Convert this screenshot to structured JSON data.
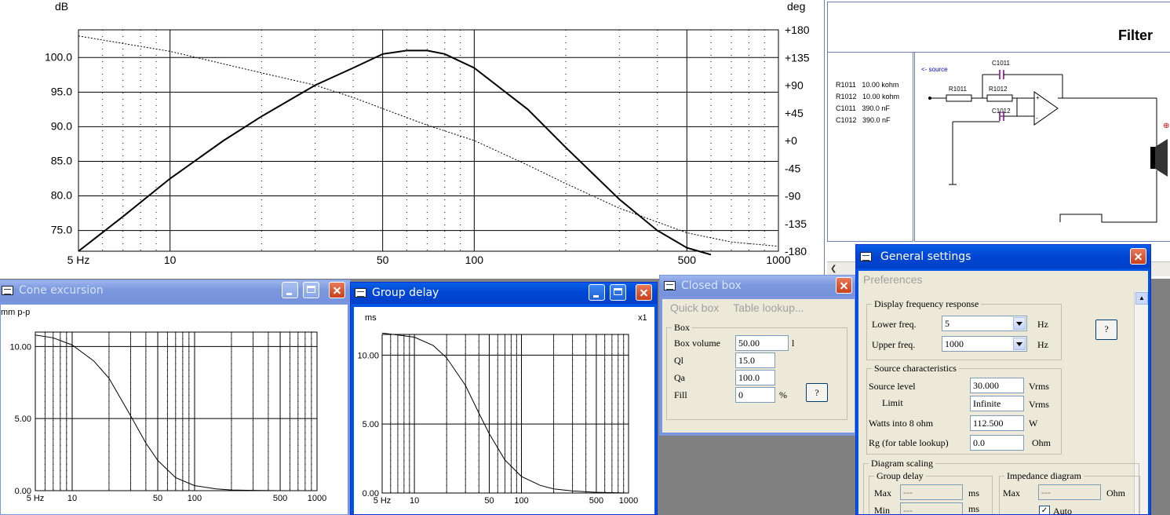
{
  "main_chart": {
    "y_unit_left": "dB",
    "y_unit_right": "deg",
    "y_ticks_left": [
      "100.0",
      "95.0",
      "90.0",
      "85.0",
      "80.0",
      "75.0"
    ],
    "y_ticks_right": [
      "+180",
      "+135",
      "+90",
      "+45",
      "+0",
      "-45",
      "-90",
      "-135",
      "-180"
    ],
    "x_ticks": [
      "5 Hz",
      "10",
      "50",
      "100",
      "500",
      "1000"
    ]
  },
  "chart_data": [
    {
      "type": "line",
      "ylabel": "dB",
      "x_scale": "log",
      "xlim": [
        5,
        1000
      ],
      "ylim": [
        72,
        104
      ],
      "y2_label": "deg",
      "y2lim": [
        -180,
        180
      ],
      "grid": true,
      "series": [
        {
          "x": [
            5,
            7,
            10,
            15,
            20,
            30,
            40,
            50,
            60,
            70,
            80,
            100,
            150,
            200,
            300,
            400,
            500,
            600
          ],
          "values": [
            72,
            77,
            82.5,
            88,
            91.5,
            96,
            98.5,
            100.5,
            101,
            101,
            100.5,
            98.5,
            92.5,
            87,
            79.5,
            75,
            72.5,
            71.5
          ]
        },
        {
          "axis": "right",
          "x": [
            5,
            10,
            20,
            30,
            40,
            50,
            70,
            100,
            150,
            200,
            300,
            500,
            700,
            1000
          ],
          "values": [
            170,
            145,
            110,
            90,
            70,
            52,
            25,
            0,
            -40,
            -70,
            -110,
            -150,
            -165,
            -172
          ]
        }
      ]
    },
    {
      "type": "line",
      "x_scale": "log",
      "xlim": [
        5,
        1000
      ],
      "ylim": [
        0,
        11
      ],
      "grid": true,
      "series": [
        {
          "x": [
            5,
            7,
            10,
            15,
            20,
            30,
            40,
            50,
            70,
            100,
            150,
            200,
            300,
            500,
            1000
          ],
          "values": [
            10.8,
            10.6,
            10.1,
            9.0,
            7.8,
            5.2,
            3.3,
            2.1,
            0.9,
            0.35,
            0.12,
            0.05,
            0.02,
            0.0,
            0.0
          ]
        }
      ]
    },
    {
      "type": "line",
      "x_scale": "log",
      "xlim": [
        5,
        1000
      ],
      "ylim": [
        0,
        11.5
      ],
      "grid": true,
      "series": [
        {
          "x": [
            5,
            10,
            15,
            20,
            30,
            40,
            50,
            70,
            100,
            150,
            200,
            300,
            500,
            1000
          ],
          "values": [
            11.6,
            11.3,
            10.7,
            9.8,
            7.8,
            5.8,
            4.3,
            2.4,
            1.2,
            0.55,
            0.3,
            0.15,
            0.05,
            0.0
          ]
        }
      ]
    }
  ],
  "filter_panel": {
    "title": "Filter",
    "components": [
      "R1011   10.00 kohm",
      "R1012   10.00 kohm",
      "C1011   390.0 nF",
      "C1012   390.0 nF"
    ],
    "source_label": "<- source",
    "schematic_labels": {
      "c1011": "C1011",
      "r1011": "R1011",
      "r1012": "R1012",
      "c1012": "C1012"
    }
  },
  "cone_window": {
    "title": "Cone excursion",
    "unit": "mm p-p",
    "y_ticks": [
      "10.00",
      "5.00",
      "0.00"
    ],
    "x_ticks": [
      "5 Hz",
      "10",
      "50",
      "100",
      "500",
      "1000"
    ]
  },
  "group_window": {
    "title": "Group delay",
    "unit": "ms",
    "scale": "x1",
    "y_ticks": [
      "10.00",
      "5.00",
      "0.00"
    ],
    "x_ticks": [
      "5 Hz",
      "10",
      "50",
      "100",
      "500",
      "1000"
    ]
  },
  "closed_box": {
    "title": "Closed box",
    "menu": [
      "Quick box",
      "Table lookup..."
    ],
    "group": "Box",
    "fields": [
      {
        "label": "Box volume",
        "value": "50.00",
        "unit": "l"
      },
      {
        "label": "Ql",
        "value": "15.0",
        "unit": ""
      },
      {
        "label": "Qa",
        "value": "100.0",
        "unit": ""
      },
      {
        "label": "Fill",
        "value": "0",
        "unit": "%"
      }
    ],
    "help": "?"
  },
  "general": {
    "title": "General settings",
    "menu": "Preferences",
    "dfr_group": "Display frequency response",
    "lower_label": "Lower freq.",
    "lower_value": "5",
    "lower_unit": "Hz",
    "upper_label": "Upper freq.",
    "upper_value": "1000",
    "upper_unit": "Hz",
    "help": "?",
    "src_group": "Source characteristics",
    "src_level_label": "Source level",
    "src_level_value": "30.000",
    "src_level_unit": "Vrms",
    "limit_label": "Limit",
    "limit_value": "Infinite",
    "limit_unit": "Vrms",
    "watts_label": "Watts into 8 ohm",
    "watts_value": "112.500",
    "watts_unit": "W",
    "rg_label": "Rg (for table lookup)",
    "rg_value": "0.0",
    "rg_unit": "Ohm",
    "diag_group": "Diagram scaling",
    "gd_group": "Group delay",
    "gd_max_label": "Max",
    "gd_max_value": "---",
    "gd_max_unit": "ms",
    "gd_min_label": "Min",
    "gd_min_value": "---",
    "gd_min_unit": "ms",
    "imp_group": "Impedance diagram",
    "imp_max_label": "Max",
    "imp_max_value": "---",
    "imp_max_unit": "Ohm",
    "auto_label": "Auto"
  }
}
